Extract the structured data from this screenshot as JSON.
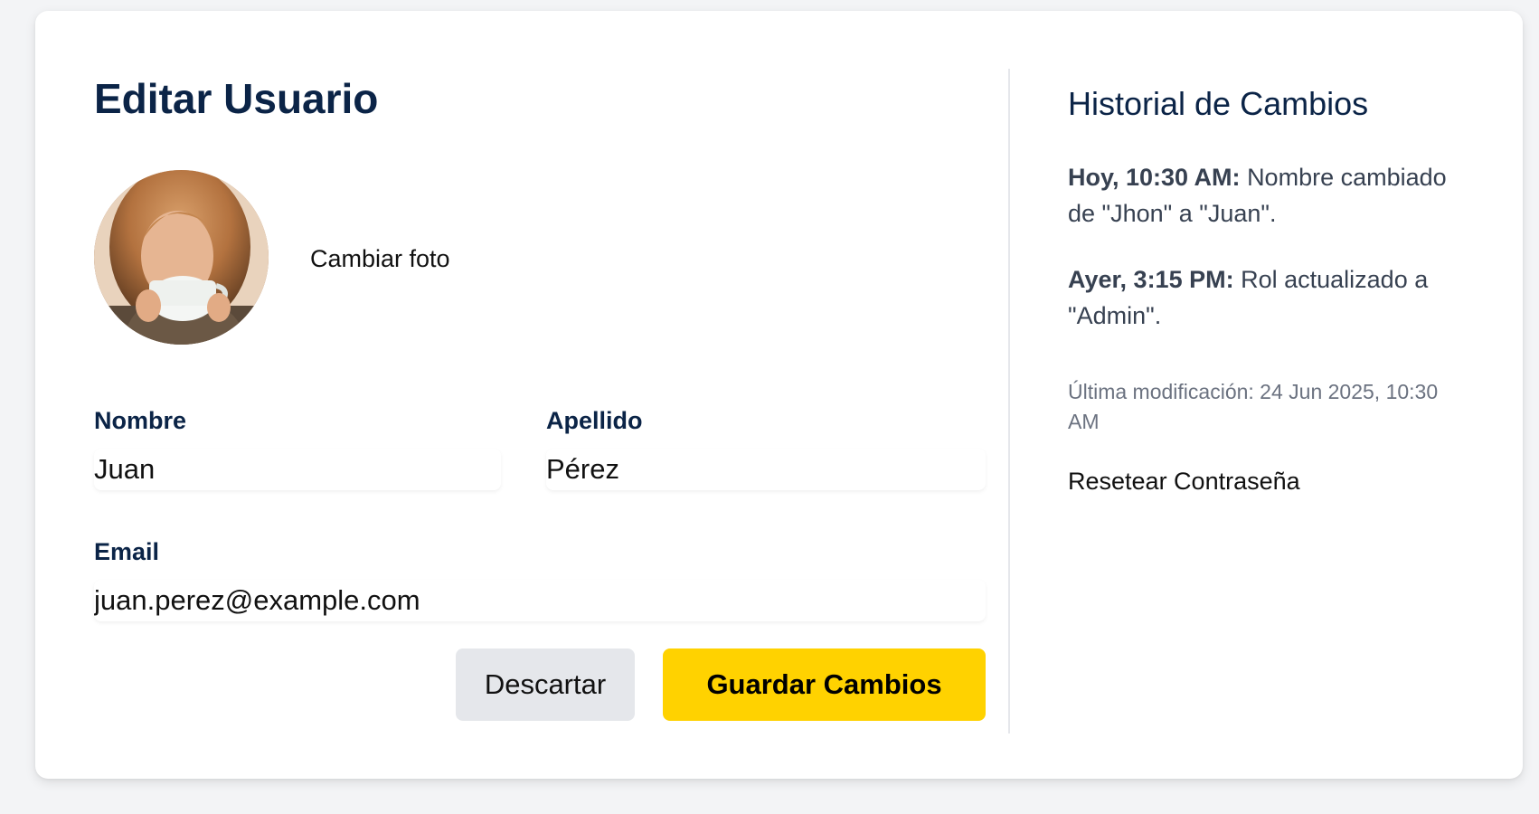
{
  "form": {
    "title": "Editar Usuario",
    "change_photo_label": "Cambiar foto",
    "fields": {
      "first_name": {
        "label": "Nombre",
        "value": "Juan"
      },
      "last_name": {
        "label": "Apellido",
        "value": "Pérez"
      },
      "email": {
        "label": "Email",
        "value": "juan.perez@example.com"
      }
    },
    "buttons": {
      "discard": "Descartar",
      "save": "Guardar Cambios"
    }
  },
  "history": {
    "title": "Historial de Cambios",
    "entries": [
      {
        "when": "Hoy, 10:30 AM:",
        "text": "Nombre cambiado de \"Jhon\" a \"Juan\"."
      },
      {
        "when": "Ayer, 3:15 PM:",
        "text": "Rol actualizado a \"Admin\"."
      }
    ],
    "last_modified": "Última modificación: 24 Jun 2025, 10:30 AM",
    "reset_password_label": "Resetear Contraseña"
  },
  "colors": {
    "primary_text": "#0b2447",
    "save_button": "#ffd200",
    "discard_button": "#e5e7eb",
    "page_background": "#f3f4f6"
  },
  "icons": {
    "avatar": "user-photo-avatar"
  }
}
